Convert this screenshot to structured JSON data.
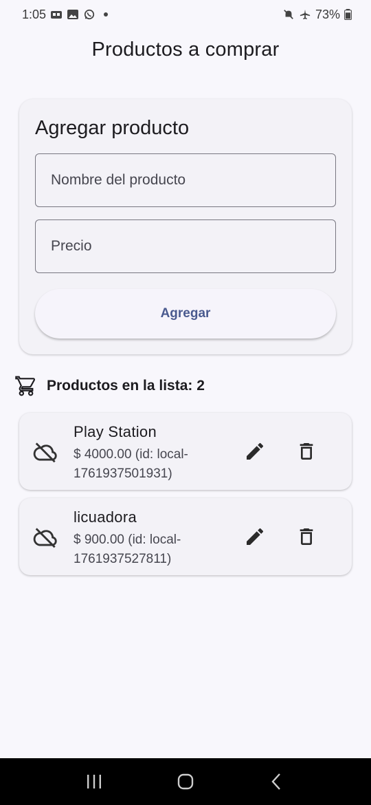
{
  "status_bar": {
    "time": "1:05",
    "battery": "73%",
    "icons": [
      "link-icon",
      "image-icon",
      "whatsapp-icon",
      "notification-dot",
      "mute-icon",
      "airplane-icon",
      "battery-icon"
    ]
  },
  "app_bar": {
    "title": "Productos a comprar"
  },
  "form": {
    "title": "Agregar producto",
    "name_placeholder": "Nombre del producto",
    "price_placeholder": "Precio",
    "add_label": "Agregar"
  },
  "list": {
    "header": "Productos en la lista: 2",
    "items": [
      {
        "name": "Play Station",
        "info": "$ 4000.00  (id: local-1761937501931)"
      },
      {
        "name": "licuadora",
        "info": "$ 900.00  (id: local-1761937527811)"
      }
    ]
  },
  "colors": {
    "background": "#f8f7fc",
    "card": "#f3f2f7",
    "button_text": "#4a5a8f",
    "nav_bar": "#000000"
  }
}
